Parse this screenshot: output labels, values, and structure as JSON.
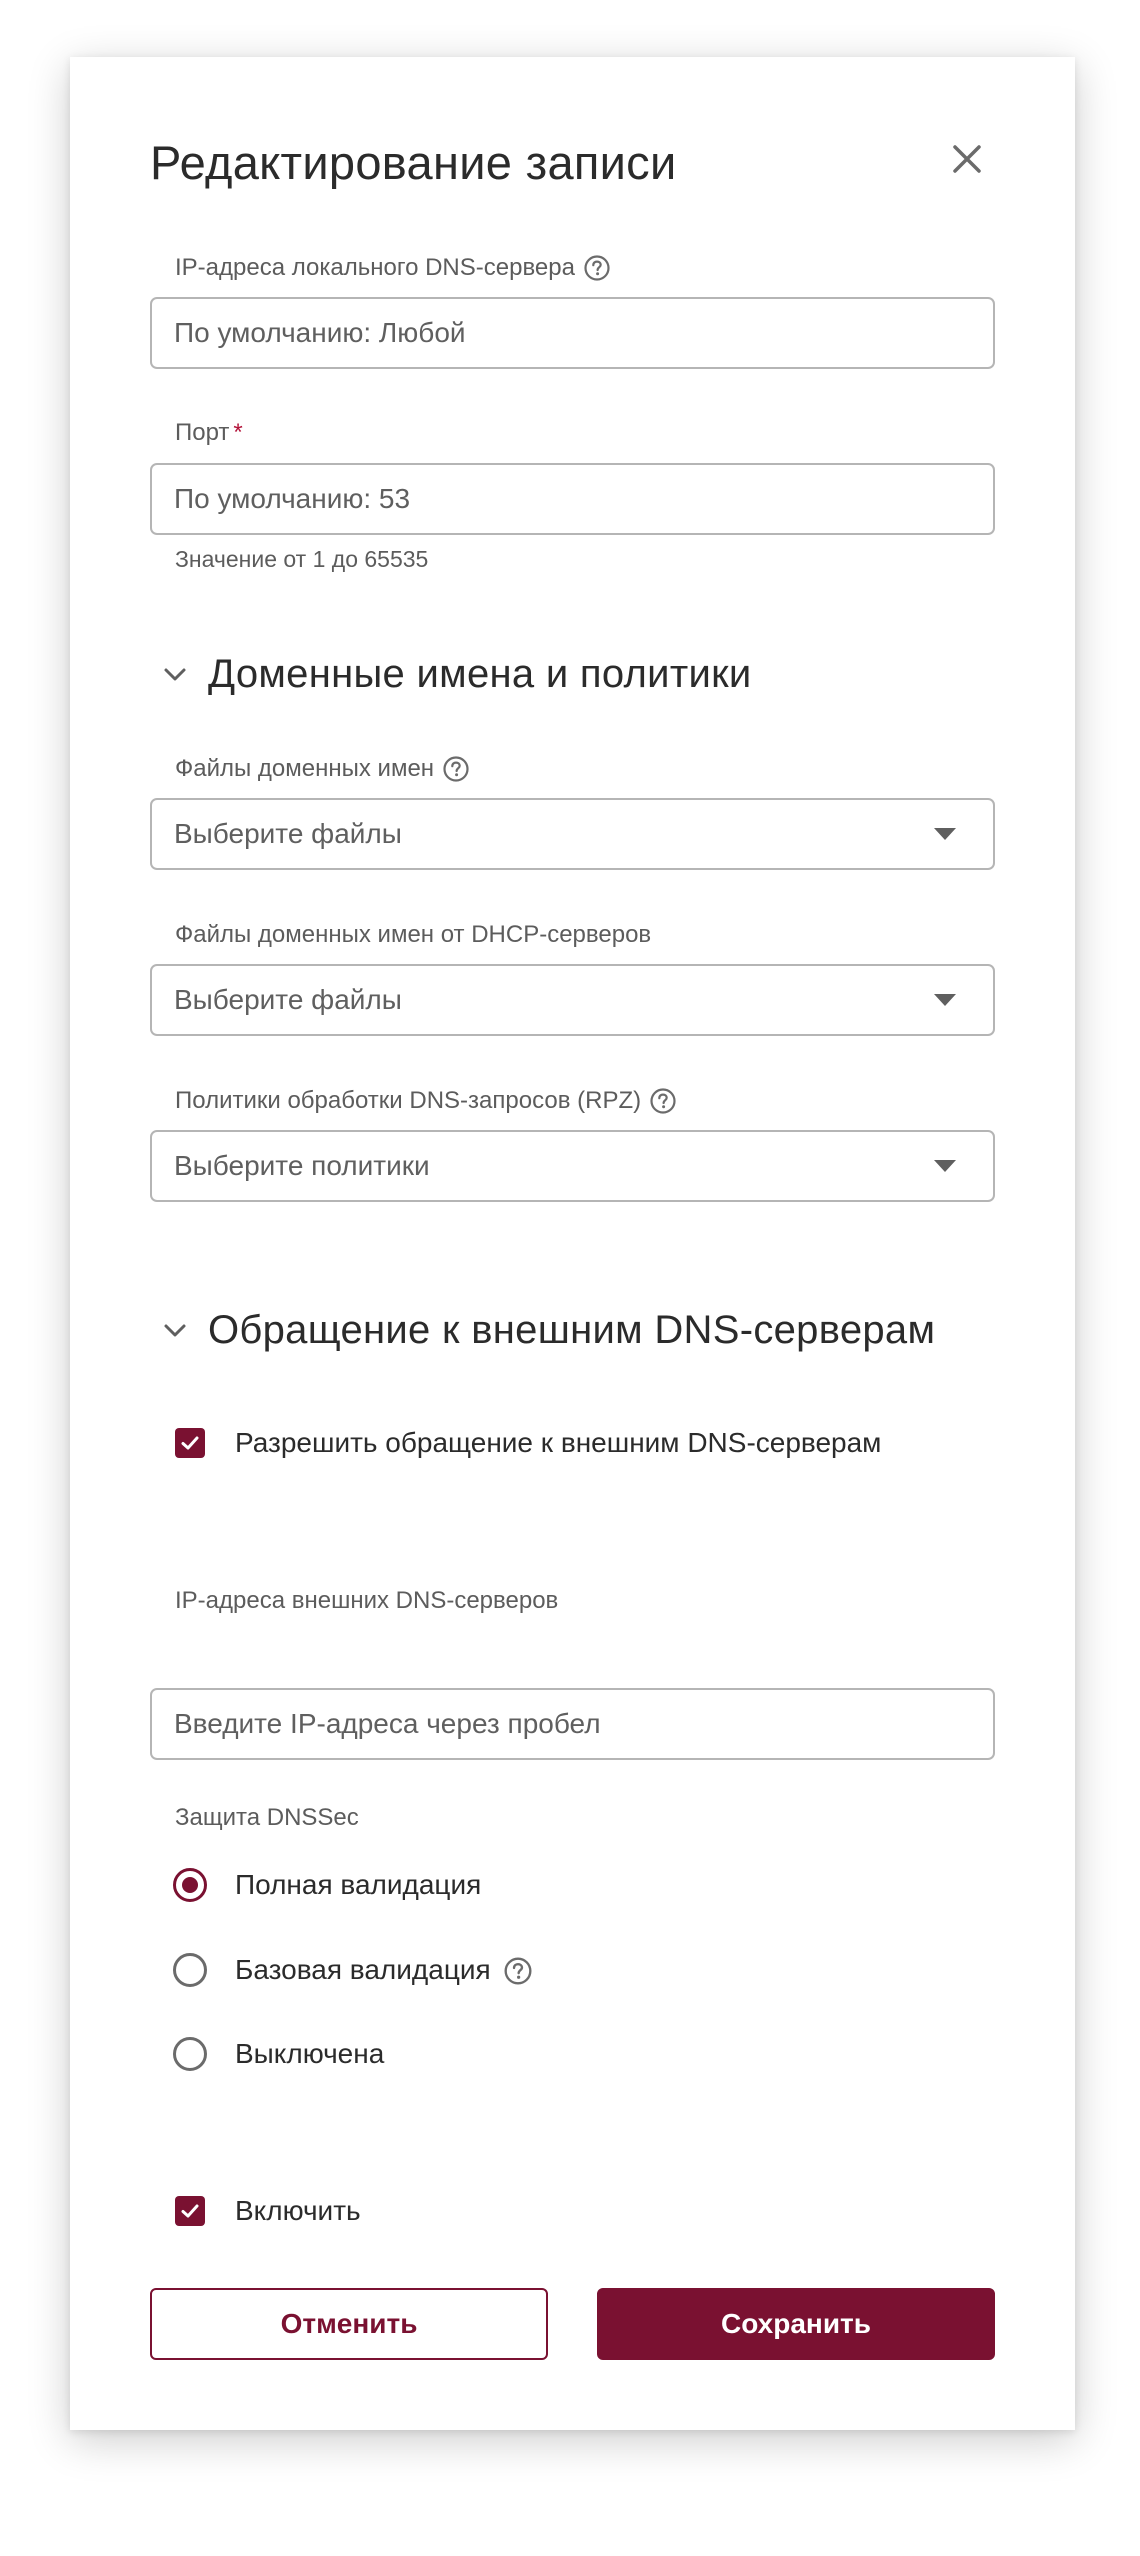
{
  "dialog": {
    "title": "Редактирование записи"
  },
  "local_dns": {
    "label": "IP-адреса локального DNS-сервера",
    "placeholder": "По умолчанию: Любой"
  },
  "port": {
    "label": "Порт",
    "required_mark": "*",
    "placeholder": "По умолчанию: 53",
    "hint": "Значение от 1 до 65535"
  },
  "domains_section": {
    "title": "Доменные имена и политики",
    "domain_files": {
      "label": "Файлы доменных имен",
      "value": "Выберите файлы"
    },
    "dhcp_files": {
      "label": "Файлы доменных имен от DHCP-серверов",
      "value": "Выберите файлы"
    },
    "rpz": {
      "label": "Политики обработки DNS-запросов (RPZ)",
      "value": "Выберите политики"
    }
  },
  "external_section": {
    "title": "Обращение к внешним DNS-серверам",
    "allow_label": "Разрешить обращение к внешним DNS-серверам",
    "allow_checked": true,
    "ips_label": "IP-адреса внешних DNS-серверов",
    "ips_placeholder": "Введите IP-адреса через пробел",
    "dnssec_label": "Защита DNSSec",
    "dnssec_options": [
      {
        "label": "Полная валидация",
        "checked": true
      },
      {
        "label": "Базовая валидация",
        "checked": false
      },
      {
        "label": "Выключена",
        "checked": false
      }
    ]
  },
  "enable": {
    "label": "Включить",
    "checked": true
  },
  "actions": {
    "cancel_label": "Отменить",
    "save_label": "Сохранить"
  },
  "colors": {
    "accent": "#7a1131",
    "required": "#b3143a",
    "border": "#b5b5b5"
  },
  "icons": {
    "close": "close-icon",
    "help": "help-circle-icon",
    "caret": "caret-down-icon",
    "chevron": "chevron-down-icon",
    "check": "check-icon"
  }
}
